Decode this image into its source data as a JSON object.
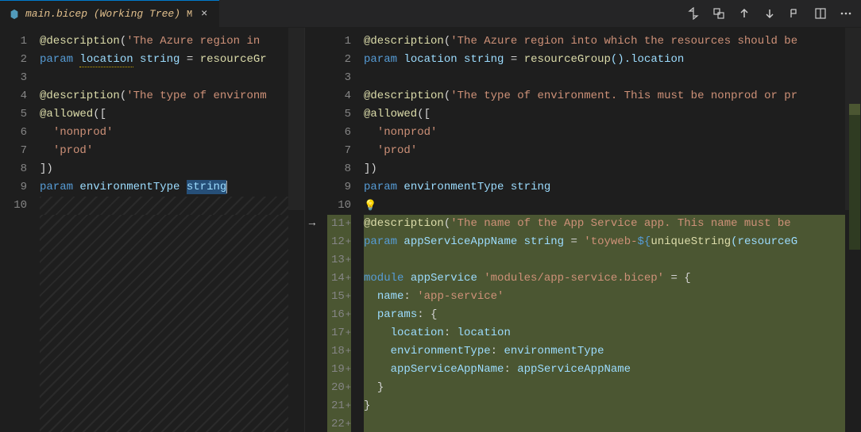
{
  "tab": {
    "filename": "main.bicep (Working Tree)",
    "status": "M",
    "close": "×"
  },
  "toolbar_icons": {
    "compare": "compare-icon",
    "swap": "swap-icon",
    "up": "up-arrow-icon",
    "down": "down-arrow-icon",
    "whitespace": "whitespace-icon",
    "split": "split-icon",
    "more": "more-icon"
  },
  "left_pane": {
    "line_numbers": [
      "1",
      "2",
      "3",
      "4",
      "5",
      "6",
      "7",
      "8",
      "9",
      "10"
    ],
    "lines": {
      "l1_desc": "@description",
      "l1_str": "'The Azure region in",
      "l2_param": "param",
      "l2_name": "location",
      "l2_type": "string",
      "l2_eq": " = ",
      "l2_call": "resourceGr",
      "l4_desc": "@description",
      "l4_str": "'The type of environm",
      "l5_allowed": "@allowed",
      "l5_bracket": "([",
      "l6_str": "'nonprod'",
      "l7_str": "'prod'",
      "l8_bracket": "])",
      "l9_param": "param",
      "l9_name": "environmentType",
      "l9_type": "string"
    }
  },
  "right_pane": {
    "line_numbers": [
      "1",
      "2",
      "3",
      "4",
      "5",
      "6",
      "7",
      "8",
      "9",
      "10",
      "11",
      "12",
      "13",
      "14",
      "15",
      "16",
      "17",
      "18",
      "19",
      "20",
      "21",
      "22"
    ],
    "lines": {
      "l1_desc": "@description",
      "l1_str": "'The Azure region into which the resources should be",
      "l2_param": "param",
      "l2_name": "location",
      "l2_type": "string",
      "l2_eq": " = ",
      "l2_call": "resourceGroup",
      "l2_prop": "().location",
      "l4_desc": "@description",
      "l4_str": "'The type of environment. This must be nonprod or pr",
      "l5_allowed": "@allowed",
      "l5_bracket": "([",
      "l6_str": "'nonprod'",
      "l7_str": "'prod'",
      "l8_bracket": "])",
      "l9_param": "param",
      "l9_name": "environmentType",
      "l9_type": "string",
      "l10_bulb": "💡",
      "l11_desc": "@description",
      "l11_str": "'The name of the App Service app. This name must be ",
      "l12_param": "param",
      "l12_name": "appServiceAppName",
      "l12_type": "string",
      "l12_eq": " = ",
      "l12_str1": "'toyweb-",
      "l12_interp": "${",
      "l12_func": "uniqueString",
      "l12_rest": "(resourceG",
      "l14_mod": "module",
      "l14_name": "appService",
      "l14_path": "'modules/app-service.bicep'",
      "l14_eq": " = {",
      "l15_prop": "name",
      "l15_val": "'app-service'",
      "l16_prop": "params",
      "l16_brace": ": {",
      "l17_prop": "location",
      "l17_val": "location",
      "l18_prop": "environmentType",
      "l18_val": "environmentType",
      "l19_prop": "appServiceAppName",
      "l19_val": "appServiceAppName",
      "l20_brace": "}",
      "l21_brace": "}"
    },
    "arrow_line": "→",
    "plus": "+"
  }
}
